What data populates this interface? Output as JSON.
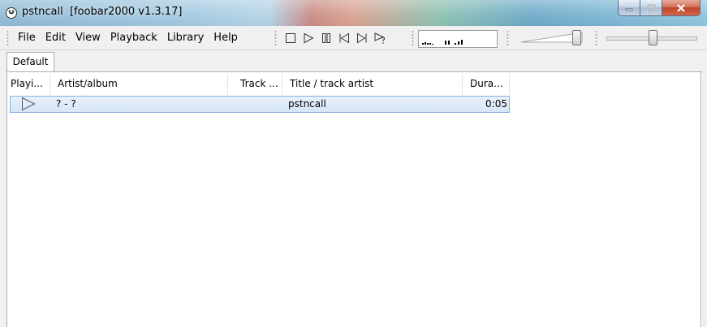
{
  "window": {
    "title": "pstncall  [foobar2000 v1.3.17]",
    "minimize_glyph": "–",
    "maximize_glyph": "☐",
    "close_glyph": "✕"
  },
  "menu": [
    "File",
    "Edit",
    "View",
    "Playback",
    "Library",
    "Help"
  ],
  "playback_controls": [
    "stop-icon",
    "play-icon",
    "pause-icon",
    "previous-icon",
    "next-icon",
    "random-icon"
  ],
  "visualization_bars": [
    2,
    3,
    2,
    2,
    1,
    5,
    5,
    2,
    4,
    6
  ],
  "volume_level": 0.92,
  "seek_position": 0.5,
  "tabs": [
    {
      "label": "Default"
    }
  ],
  "playlist": {
    "columns": [
      "Playi...",
      "Artist/album",
      "Track ...",
      "Title / track artist",
      "Dura..."
    ],
    "rows": [
      {
        "playing": "play-outline-icon",
        "artist_album": "? - ?",
        "track": "",
        "title": "pstncall",
        "duration": "0:05"
      }
    ]
  },
  "colors": {
    "selection": "#d6e6f7",
    "selection_border": "#84acdd",
    "chrome": "#f0f0f0"
  }
}
